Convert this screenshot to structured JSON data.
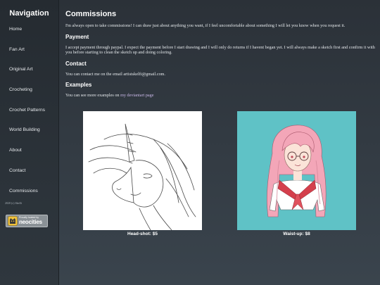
{
  "sidebar": {
    "title": "Navigation",
    "items": [
      {
        "label": "Home"
      },
      {
        "label": "Fan Art"
      },
      {
        "label": "Original Art"
      },
      {
        "label": "Crocheting"
      },
      {
        "label": "Crochet Patterns"
      },
      {
        "label": "World Building"
      },
      {
        "label": "About"
      },
      {
        "label": "Contact"
      },
      {
        "label": "Commissions"
      }
    ],
    "copyright": "2020 (c) Skelfi",
    "badge": {
      "top": "Proudly hosted by",
      "main": "neocities"
    }
  },
  "main": {
    "title": "Commissions",
    "intro": "I'm always open to take commissions! I can draw just about anything you want, if I feel uncomfortable about something I will let you know when you request it.",
    "payment": {
      "heading": "Payment",
      "text": "I accept payment through paypal. I expect the payment before I start drawing and I will only do returns if I havent began yet. I will always make a sketch first and confirm it with you before starting to clean the sketch up and doing coloring."
    },
    "contact": {
      "heading": "Contact",
      "text": "You can contact me on the email artistskelfi@gmail.com."
    },
    "examples": {
      "heading": "Examples",
      "text_prefix": "You can see more examples on ",
      "link": "my deviantart page"
    }
  },
  "gallery": [
    {
      "caption": "Head-shot: $5",
      "bg": "#ffffff"
    },
    {
      "caption": "Waist-up: $8",
      "bg": "#5fc2c6"
    }
  ],
  "colors": {
    "background": "#333b42",
    "sidebar": "#2a3036",
    "link": "#c7b7e6",
    "hair": "#f3a6b8",
    "sailor_tie": "#e0525d"
  }
}
